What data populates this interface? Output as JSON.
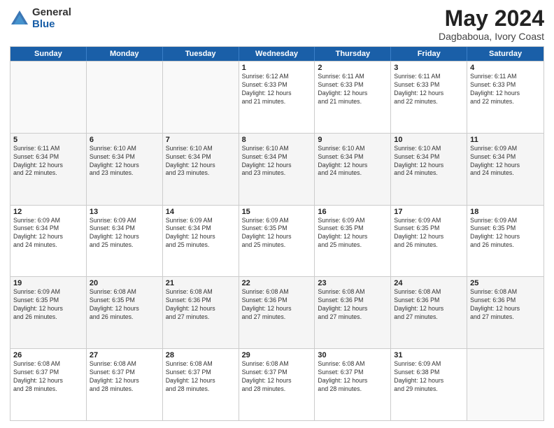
{
  "logo": {
    "general": "General",
    "blue": "Blue"
  },
  "title": {
    "month": "May 2024",
    "location": "Dagbaboua, Ivory Coast"
  },
  "calendar": {
    "headers": [
      "Sunday",
      "Monday",
      "Tuesday",
      "Wednesday",
      "Thursday",
      "Friday",
      "Saturday"
    ],
    "rows": [
      [
        {
          "date": "",
          "info": ""
        },
        {
          "date": "",
          "info": ""
        },
        {
          "date": "",
          "info": ""
        },
        {
          "date": "1",
          "info": "Sunrise: 6:12 AM\nSunset: 6:33 PM\nDaylight: 12 hours\nand 21 minutes."
        },
        {
          "date": "2",
          "info": "Sunrise: 6:11 AM\nSunset: 6:33 PM\nDaylight: 12 hours\nand 21 minutes."
        },
        {
          "date": "3",
          "info": "Sunrise: 6:11 AM\nSunset: 6:33 PM\nDaylight: 12 hours\nand 22 minutes."
        },
        {
          "date": "4",
          "info": "Sunrise: 6:11 AM\nSunset: 6:33 PM\nDaylight: 12 hours\nand 22 minutes."
        }
      ],
      [
        {
          "date": "5",
          "info": "Sunrise: 6:11 AM\nSunset: 6:34 PM\nDaylight: 12 hours\nand 22 minutes."
        },
        {
          "date": "6",
          "info": "Sunrise: 6:10 AM\nSunset: 6:34 PM\nDaylight: 12 hours\nand 23 minutes."
        },
        {
          "date": "7",
          "info": "Sunrise: 6:10 AM\nSunset: 6:34 PM\nDaylight: 12 hours\nand 23 minutes."
        },
        {
          "date": "8",
          "info": "Sunrise: 6:10 AM\nSunset: 6:34 PM\nDaylight: 12 hours\nand 23 minutes."
        },
        {
          "date": "9",
          "info": "Sunrise: 6:10 AM\nSunset: 6:34 PM\nDaylight: 12 hours\nand 24 minutes."
        },
        {
          "date": "10",
          "info": "Sunrise: 6:10 AM\nSunset: 6:34 PM\nDaylight: 12 hours\nand 24 minutes."
        },
        {
          "date": "11",
          "info": "Sunrise: 6:09 AM\nSunset: 6:34 PM\nDaylight: 12 hours\nand 24 minutes."
        }
      ],
      [
        {
          "date": "12",
          "info": "Sunrise: 6:09 AM\nSunset: 6:34 PM\nDaylight: 12 hours\nand 24 minutes."
        },
        {
          "date": "13",
          "info": "Sunrise: 6:09 AM\nSunset: 6:34 PM\nDaylight: 12 hours\nand 25 minutes."
        },
        {
          "date": "14",
          "info": "Sunrise: 6:09 AM\nSunset: 6:34 PM\nDaylight: 12 hours\nand 25 minutes."
        },
        {
          "date": "15",
          "info": "Sunrise: 6:09 AM\nSunset: 6:35 PM\nDaylight: 12 hours\nand 25 minutes."
        },
        {
          "date": "16",
          "info": "Sunrise: 6:09 AM\nSunset: 6:35 PM\nDaylight: 12 hours\nand 25 minutes."
        },
        {
          "date": "17",
          "info": "Sunrise: 6:09 AM\nSunset: 6:35 PM\nDaylight: 12 hours\nand 26 minutes."
        },
        {
          "date": "18",
          "info": "Sunrise: 6:09 AM\nSunset: 6:35 PM\nDaylight: 12 hours\nand 26 minutes."
        }
      ],
      [
        {
          "date": "19",
          "info": "Sunrise: 6:09 AM\nSunset: 6:35 PM\nDaylight: 12 hours\nand 26 minutes."
        },
        {
          "date": "20",
          "info": "Sunrise: 6:08 AM\nSunset: 6:35 PM\nDaylight: 12 hours\nand 26 minutes."
        },
        {
          "date": "21",
          "info": "Sunrise: 6:08 AM\nSunset: 6:36 PM\nDaylight: 12 hours\nand 27 minutes."
        },
        {
          "date": "22",
          "info": "Sunrise: 6:08 AM\nSunset: 6:36 PM\nDaylight: 12 hours\nand 27 minutes."
        },
        {
          "date": "23",
          "info": "Sunrise: 6:08 AM\nSunset: 6:36 PM\nDaylight: 12 hours\nand 27 minutes."
        },
        {
          "date": "24",
          "info": "Sunrise: 6:08 AM\nSunset: 6:36 PM\nDaylight: 12 hours\nand 27 minutes."
        },
        {
          "date": "25",
          "info": "Sunrise: 6:08 AM\nSunset: 6:36 PM\nDaylight: 12 hours\nand 27 minutes."
        }
      ],
      [
        {
          "date": "26",
          "info": "Sunrise: 6:08 AM\nSunset: 6:37 PM\nDaylight: 12 hours\nand 28 minutes."
        },
        {
          "date": "27",
          "info": "Sunrise: 6:08 AM\nSunset: 6:37 PM\nDaylight: 12 hours\nand 28 minutes."
        },
        {
          "date": "28",
          "info": "Sunrise: 6:08 AM\nSunset: 6:37 PM\nDaylight: 12 hours\nand 28 minutes."
        },
        {
          "date": "29",
          "info": "Sunrise: 6:08 AM\nSunset: 6:37 PM\nDaylight: 12 hours\nand 28 minutes."
        },
        {
          "date": "30",
          "info": "Sunrise: 6:08 AM\nSunset: 6:37 PM\nDaylight: 12 hours\nand 28 minutes."
        },
        {
          "date": "31",
          "info": "Sunrise: 6:09 AM\nSunset: 6:38 PM\nDaylight: 12 hours\nand 29 minutes."
        },
        {
          "date": "",
          "info": ""
        }
      ]
    ]
  }
}
